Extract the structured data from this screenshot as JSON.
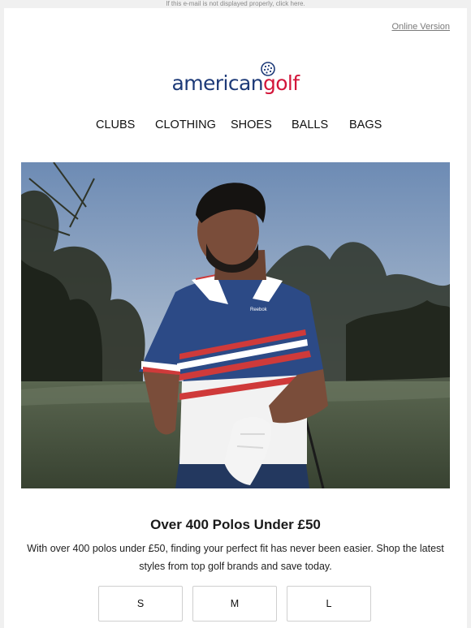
{
  "preheader": "If this e-mail is not displayed properly, click here.",
  "online_version": "Online Version",
  "logo": {
    "part1": "american",
    "part2": "golf"
  },
  "nav": [
    "CLUBS",
    "CLOTHING",
    "SHOES",
    "BALLS",
    "BAGS"
  ],
  "hero": {
    "shirt_brand": "Reebok"
  },
  "heading": "Over 400 Polos Under £50",
  "body": "With over 400 polos under £50, finding your perfect fit has never been easier. Shop the latest styles from top golf brands and save today.",
  "sizes": [
    "S",
    "M",
    "L"
  ],
  "colors": {
    "brand_blue": "#1d3a78",
    "brand_red": "#d3163a"
  }
}
